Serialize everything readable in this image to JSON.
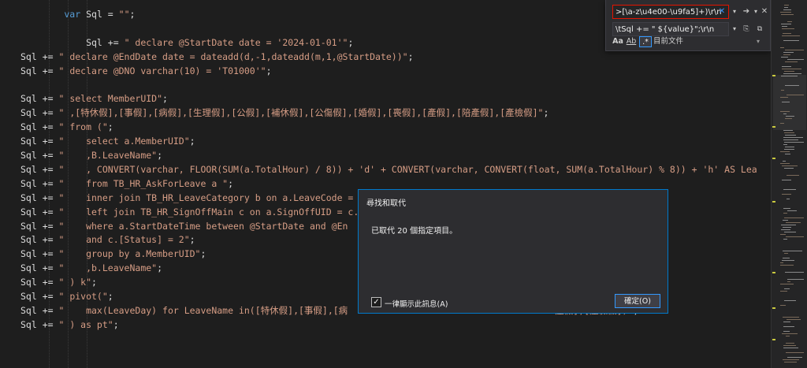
{
  "editor": {
    "lines": [
      {
        "parts": [
          {
            "c": "kw",
            "t": "        var"
          },
          {
            "c": "plain",
            "t": " Sql = "
          },
          {
            "c": "str",
            "t": "\"\""
          },
          {
            "c": "plain",
            "t": ";"
          }
        ]
      },
      {
        "parts": [
          {
            "c": "plain",
            "t": ""
          }
        ]
      },
      {
        "parts": [
          {
            "c": "plain",
            "t": "            Sql += "
          },
          {
            "c": "str",
            "t": "\" declare @StartDate date = '2024-01-01'\""
          },
          {
            "c": "plain",
            "t": ";"
          }
        ]
      },
      {
        "parts": [
          {
            "c": "plain",
            "t": "Sql += "
          },
          {
            "c": "str",
            "t": "\" declare @EndDate date = dateadd(d,-1,dateadd(m,1,@StartDate))\""
          },
          {
            "c": "plain",
            "t": ";"
          }
        ]
      },
      {
        "parts": [
          {
            "c": "plain",
            "t": "Sql += "
          },
          {
            "c": "str",
            "t": "\" declare @DNO varchar(10) = 'T01000'\""
          },
          {
            "c": "plain",
            "t": ";"
          }
        ]
      },
      {
        "parts": [
          {
            "c": "plain",
            "t": ""
          }
        ]
      },
      {
        "parts": [
          {
            "c": "plain",
            "t": "Sql += "
          },
          {
            "c": "str",
            "t": "\" select MemberUID\""
          },
          {
            "c": "plain",
            "t": ";"
          }
        ]
      },
      {
        "parts": [
          {
            "c": "plain",
            "t": "Sql += "
          },
          {
            "c": "str",
            "t": "\" ,[特休假],[事假],[病假],[生理假],[公假],[補休假],[公傷假],[婚假],[喪假],[產假],[陪產假],[產檢假]\""
          },
          {
            "c": "plain",
            "t": ";"
          }
        ]
      },
      {
        "parts": [
          {
            "c": "plain",
            "t": "Sql += "
          },
          {
            "c": "str",
            "t": "\" from (\""
          },
          {
            "c": "plain",
            "t": ";"
          }
        ]
      },
      {
        "parts": [
          {
            "c": "plain",
            "t": "Sql += "
          },
          {
            "c": "str",
            "t": "\"    select a.MemberUID\""
          },
          {
            "c": "plain",
            "t": ";"
          }
        ]
      },
      {
        "parts": [
          {
            "c": "plain",
            "t": "Sql += "
          },
          {
            "c": "str",
            "t": "\"    ,B.LeaveName\""
          },
          {
            "c": "plain",
            "t": ";"
          }
        ]
      },
      {
        "parts": [
          {
            "c": "plain",
            "t": "Sql += "
          },
          {
            "c": "str",
            "t": "\"    , CONVERT(varchar, FLOOR(SUM(a.TotalHour) / 8)) + 'd' + CONVERT(varchar, CONVERT(float, SUM(a.TotalHour) % 8)) + 'h' AS Lea"
          }
        ]
      },
      {
        "parts": [
          {
            "c": "plain",
            "t": "Sql += "
          },
          {
            "c": "str",
            "t": "\"    from TB_HR_AskForLeave a \""
          },
          {
            "c": "plain",
            "t": ";"
          }
        ]
      },
      {
        "parts": [
          {
            "c": "plain",
            "t": "Sql += "
          },
          {
            "c": "str",
            "t": "\"    inner join TB_HR_LeaveCategory b on a.LeaveCode = b.LeaveCategoryID\""
          },
          {
            "c": "plain",
            "t": ";"
          }
        ]
      },
      {
        "parts": [
          {
            "c": "plain",
            "t": "Sql += "
          },
          {
            "c": "str",
            "t": "\"    left join TB_HR_SignOffMain c on a.SignOffUID = c.MainUID\""
          },
          {
            "c": "plain",
            "t": ";"
          }
        ]
      },
      {
        "parts": [
          {
            "c": "plain",
            "t": "Sql += "
          },
          {
            "c": "str",
            "t": "\"    where a.StartDateTime between @StartDate and @En"
          }
        ]
      },
      {
        "parts": [
          {
            "c": "plain",
            "t": "Sql += "
          },
          {
            "c": "str",
            "t": "\"    and c.[Status] = 2\""
          },
          {
            "c": "plain",
            "t": ";"
          }
        ]
      },
      {
        "parts": [
          {
            "c": "plain",
            "t": "Sql += "
          },
          {
            "c": "str",
            "t": "\"    group by a.MemberUID\""
          },
          {
            "c": "plain",
            "t": ";"
          }
        ]
      },
      {
        "parts": [
          {
            "c": "plain",
            "t": "Sql += "
          },
          {
            "c": "str",
            "t": "\"    ,b.LeaveName\""
          },
          {
            "c": "plain",
            "t": ";"
          }
        ]
      },
      {
        "parts": [
          {
            "c": "plain",
            "t": "Sql += "
          },
          {
            "c": "str",
            "t": "\" ) k\""
          },
          {
            "c": "plain",
            "t": ";"
          }
        ]
      },
      {
        "parts": [
          {
            "c": "plain",
            "t": "Sql += "
          },
          {
            "c": "str",
            "t": "\" pivot(\""
          },
          {
            "c": "plain",
            "t": ";"
          }
        ]
      },
      {
        "parts": [
          {
            "c": "plain",
            "t": "Sql += "
          },
          {
            "c": "str",
            "t": "\"    max(LeaveDay) for LeaveName in([特休假],[事假],[病"
          },
          {
            "c": "plain",
            "t": "                                      "
          },
          {
            "c": "str",
            "t": "產假],[產檢假])\""
          },
          {
            "c": "plain",
            "t": ";"
          }
        ]
      },
      {
        "parts": [
          {
            "c": "plain",
            "t": "Sql += "
          },
          {
            "c": "str",
            "t": "\" ) as pt\""
          },
          {
            "c": "plain",
            "t": ";"
          }
        ]
      }
    ]
  },
  "find_widget": {
    "find_value": ">[\\a-z\\u4e00-\\u9fa5]+)\\r\\n",
    "replace_value": "\\tSql += \" ${value}\";\\r\\n",
    "scope_label": "目前文件",
    "match_case_label": "Aa",
    "whole_word_label": "Ab",
    "regex_label": ".*"
  },
  "dialog": {
    "title": "尋找和取代",
    "message": "已取代 20 個指定項目。",
    "checkbox_label": "一律顯示此訊息(A)",
    "checkbox_checked": true,
    "ok_label": "確定(O)"
  }
}
